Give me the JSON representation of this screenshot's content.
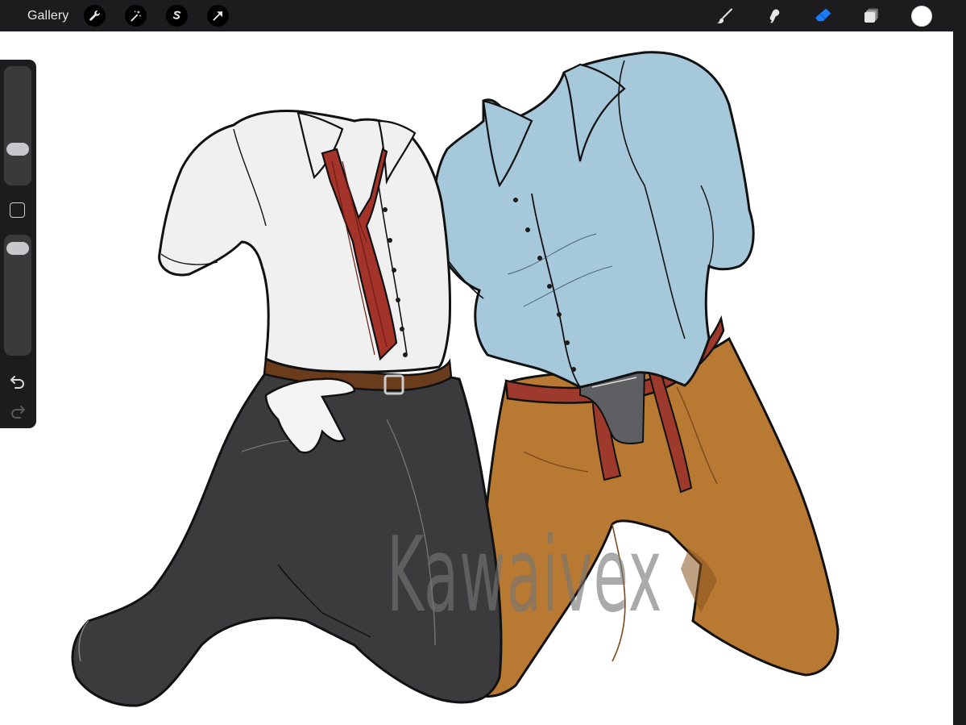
{
  "toolbar": {
    "gallery_label": "Gallery",
    "left_tools": [
      "wrench-icon",
      "magic-wand-icon",
      "selection-s-icon",
      "transform-arrow-icon"
    ],
    "right_tools": [
      "brush-icon",
      "smudge-icon",
      "eraser-icon",
      "layers-icon"
    ],
    "active_tool": "eraser",
    "active_color": "#1a7cf5",
    "current_color": "#ffffff"
  },
  "sidebar": {
    "brush_size_level": 0.27,
    "opacity_level": 0.95,
    "undo_icon": "undo-icon",
    "redo_icon": "redo-icon"
  },
  "artwork": {
    "watermark": "Kawaivex",
    "left_figure": "white-shirt-black-jeans",
    "right_figure": "blue-shirt-brown-pants"
  }
}
